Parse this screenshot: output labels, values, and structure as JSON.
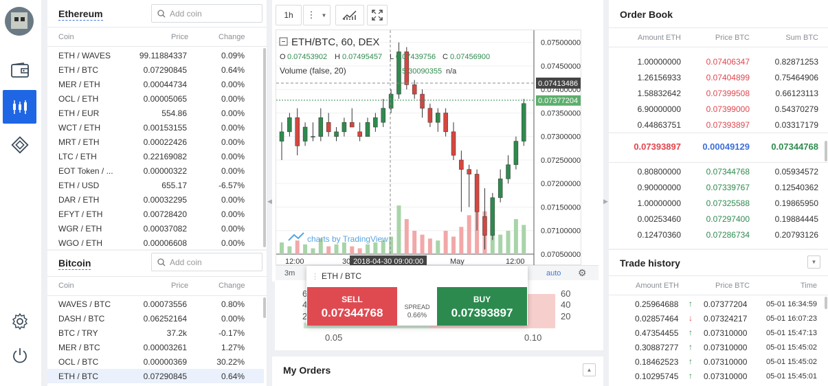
{
  "sidebar": {
    "icons": [
      "wallet-icon",
      "candlestick-chart-icon",
      "diamond-exchange-icon",
      "settings-icon",
      "power-icon"
    ]
  },
  "ethereum": {
    "title": "Ethereum",
    "search_placeholder": "Add coin",
    "headers": {
      "coin": "Coin",
      "price": "Price",
      "change": "Change"
    },
    "rows": [
      {
        "pair": "ETH / WAVES",
        "price": "99.11884337",
        "change": "0.09%"
      },
      {
        "pair": "ETH / BTC",
        "price": "0.07290845",
        "change": "0.64%"
      },
      {
        "pair": "MER / ETH",
        "price": "0.00044734",
        "change": "0.00%"
      },
      {
        "pair": "OCL / ETH",
        "price": "0.00005065",
        "change": "0.00%"
      },
      {
        "pair": "ETH / EUR",
        "price": "554.86",
        "change": "0.00%"
      },
      {
        "pair": "WCT / ETH",
        "price": "0.00153155",
        "change": "0.00%"
      },
      {
        "pair": "MRT / ETH",
        "price": "0.00022426",
        "change": "0.00%"
      },
      {
        "pair": "LTC / ETH",
        "price": "0.22169082",
        "change": "0.00%"
      },
      {
        "pair": "EOT Token / ...",
        "price": "0.00000322",
        "change": "0.00%"
      },
      {
        "pair": "ETH / USD",
        "price": "655.17",
        "change": "-6.57%"
      },
      {
        "pair": "DAR / ETH",
        "price": "0.00032295",
        "change": "0.00%"
      },
      {
        "pair": "EFYT / ETH",
        "price": "0.00728420",
        "change": "0.00%"
      },
      {
        "pair": "WGR / ETH",
        "price": "0.00037082",
        "change": "0.00%"
      },
      {
        "pair": "WGO / ETH",
        "price": "0.00006608",
        "change": "0.00%"
      }
    ]
  },
  "bitcoin": {
    "title": "Bitcoin",
    "search_placeholder": "Add coin",
    "headers": {
      "coin": "Coin",
      "price": "Price",
      "change": "Change"
    },
    "rows": [
      {
        "pair": "WAVES / BTC",
        "price": "0.00073556",
        "change": "0.80%"
      },
      {
        "pair": "DASH / BTC",
        "price": "0.06252164",
        "change": "0.00%"
      },
      {
        "pair": "BTC / TRY",
        "price": "37.2k",
        "change": "-0.17%"
      },
      {
        "pair": "MER / BTC",
        "price": "0.00003261",
        "change": "1.27%"
      },
      {
        "pair": "OCL / BTC",
        "price": "0.00000369",
        "change": "30.22%"
      },
      {
        "pair": "ETH / BTC",
        "price": "0.07290845",
        "change": "0.64%"
      }
    ]
  },
  "chart": {
    "interval_button": "1h",
    "symbol_line": "ETH/BTC, 60, DEX",
    "ohlc": {
      "o_label": "O",
      "o": "0.07453902",
      "h_label": "H",
      "h": "0.07495457",
      "l_label": "L",
      "l": "0.07439756",
      "c_label": "C",
      "c": "0.07456900"
    },
    "volume_label": "Volume (false, 20)",
    "volume_value": "5.30090355",
    "volume_na": "n/a",
    "watermark": "charts by TradingView",
    "y_ticks": [
      "0.07500000",
      "0.07450000",
      "0.07400000",
      "0.07350000",
      "0.07300000",
      "0.07250000",
      "0.07200000",
      "0.07150000",
      "0.07100000",
      "0.07050000"
    ],
    "badge_dark": "0.07413486",
    "badge_green": "0.07377204",
    "x_ticks": [
      "12:00",
      "30",
      "May",
      "12:00"
    ],
    "x_cursor_label": "2018-04-30 09:00:00",
    "bottom_left": "3m",
    "bottom_auto": "auto",
    "colors": {
      "up": "#2f8a4e",
      "down": "#d4473f",
      "vol_up": "#a8d4a8",
      "vol_down": "#f2a8a8"
    }
  },
  "chart_data": {
    "type": "candlestick",
    "title": "ETH/BTC, 60, DEX",
    "ylim": [
      0.0705,
      0.0752
    ],
    "candles": [
      [
        0.0729,
        0.0733,
        0.0725,
        0.0731
      ],
      [
        0.0731,
        0.0735,
        0.073,
        0.0734
      ],
      [
        0.0734,
        0.0736,
        0.0726,
        0.0728
      ],
      [
        0.0729,
        0.0733,
        0.0728,
        0.0732
      ],
      [
        0.073,
        0.0733,
        0.0729,
        0.073
      ],
      [
        0.073,
        0.0736,
        0.0729,
        0.0734
      ],
      [
        0.0733,
        0.0735,
        0.073,
        0.0731
      ],
      [
        0.073,
        0.0732,
        0.0729,
        0.0731
      ],
      [
        0.0731,
        0.0734,
        0.073,
        0.0733
      ],
      [
        0.0733,
        0.0736,
        0.0732,
        0.0732
      ],
      [
        0.0731,
        0.0733,
        0.0729,
        0.073
      ],
      [
        0.073,
        0.0734,
        0.073,
        0.0733
      ],
      [
        0.0732,
        0.0735,
        0.0731,
        0.0734
      ],
      [
        0.0733,
        0.0738,
        0.0732,
        0.0736
      ],
      [
        0.0736,
        0.074,
        0.0735,
        0.0739
      ],
      [
        0.0739,
        0.075,
        0.0738,
        0.0748
      ],
      [
        0.0748,
        0.0749,
        0.074,
        0.0741
      ],
      [
        0.0741,
        0.0742,
        0.0738,
        0.0739
      ],
      [
        0.0739,
        0.074,
        0.0734,
        0.0736
      ],
      [
        0.0736,
        0.0737,
        0.0732,
        0.0733
      ],
      [
        0.0733,
        0.0736,
        0.0731,
        0.0735
      ],
      [
        0.0735,
        0.0736,
        0.073,
        0.0731
      ],
      [
        0.0731,
        0.0733,
        0.0725,
        0.0726
      ],
      [
        0.0725,
        0.0727,
        0.0714,
        0.0723
      ],
      [
        0.0723,
        0.0724,
        0.0715,
        0.0722
      ],
      [
        0.0722,
        0.0723,
        0.071,
        0.0714
      ],
      [
        0.0713,
        0.0719,
        0.0706,
        0.0709
      ],
      [
        0.0709,
        0.0718,
        0.0708,
        0.0717
      ],
      [
        0.0717,
        0.0723,
        0.0716,
        0.0721
      ],
      [
        0.0721,
        0.0726,
        0.072,
        0.0724
      ],
      [
        0.0724,
        0.073,
        0.0723,
        0.0729
      ],
      [
        0.0729,
        0.0738,
        0.0728,
        0.0737
      ]
    ],
    "volumes": [
      6,
      4,
      7,
      5,
      3,
      8,
      4,
      5,
      6,
      4,
      3,
      5,
      6,
      7,
      9,
      25,
      18,
      12,
      10,
      8,
      7,
      12,
      9,
      14,
      20,
      30,
      22,
      16,
      10,
      12,
      18,
      15
    ]
  },
  "orderbook": {
    "title": "Order Book",
    "headers": {
      "amount": "Amount ETH",
      "price": "Price BTC",
      "sum": "Sum BTC"
    },
    "asks": [
      {
        "amount": "1.00000000",
        "price": "0.07406347",
        "sum": "0.82871253"
      },
      {
        "amount": "1.26156933",
        "price": "0.07404899",
        "sum": "0.75464906"
      },
      {
        "amount": "1.58832642",
        "price": "0.07399508",
        "sum": "0.66123113"
      },
      {
        "amount": "6.90000000",
        "price": "0.07399000",
        "sum": "0.54370279"
      },
      {
        "amount": "0.44863751",
        "price": "0.07393897",
        "sum": "0.03317179"
      }
    ],
    "spread": {
      "ask": "0.07393897",
      "spread": "0.00049129",
      "bid": "0.07344768"
    },
    "bids": [
      {
        "amount": "0.80800000",
        "price": "0.07344768",
        "sum": "0.05934572"
      },
      {
        "amount": "0.90000000",
        "price": "0.07339767",
        "sum": "0.12540362"
      },
      {
        "amount": "1.00000000",
        "price": "0.07325588",
        "sum": "0.19865950"
      },
      {
        "amount": "0.00253460",
        "price": "0.07297400",
        "sum": "0.19884445"
      },
      {
        "amount": "0.12470360",
        "price": "0.07286734",
        "sum": "0.20793126"
      }
    ]
  },
  "trades": {
    "title": "Trade history",
    "headers": {
      "amount": "Amount ETH",
      "price": "Price BTC",
      "time": "Time"
    },
    "rows": [
      {
        "amount": "0.25964688",
        "dir": "up",
        "price": "0.07377204",
        "time": "05-01 16:34:59"
      },
      {
        "amount": "0.02857464",
        "dir": "down",
        "price": "0.07324217",
        "time": "05-01 16:07:23"
      },
      {
        "amount": "0.47354455",
        "dir": "up",
        "price": "0.07310000",
        "time": "05-01 15:47:13"
      },
      {
        "amount": "0.30887277",
        "dir": "up",
        "price": "0.07310000",
        "time": "05-01 15:45:02"
      },
      {
        "amount": "0.18462523",
        "dir": "up",
        "price": "0.07310000",
        "time": "05-01 15:45:02"
      },
      {
        "amount": "0.10295745",
        "dir": "up",
        "price": "0.07310000",
        "time": "05-01 15:45:01"
      }
    ]
  },
  "trade_widget": {
    "pair": "ETH / BTC",
    "sell_label": "SELL",
    "sell_price": "0.07344768",
    "spread_label": "SPREAD",
    "spread_value": "0.66%",
    "buy_label": "BUY",
    "buy_price": "0.07393897"
  },
  "depth": {
    "left_ticks": [
      "60",
      "40",
      "20"
    ],
    "right_ticks": [
      "60",
      "40",
      "20"
    ],
    "x_ticks": [
      "0.05",
      "0.10"
    ]
  },
  "my_orders": {
    "title": "My Orders"
  }
}
